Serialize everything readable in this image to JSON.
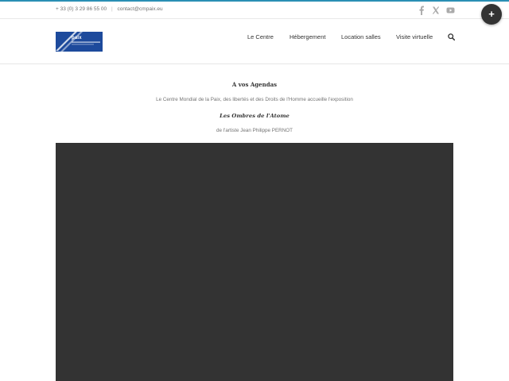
{
  "topbar": {
    "phone": "+ 33 (0) 3 29 86 55 00",
    "separator": "|",
    "email": "contact@cmpaix.eu",
    "social": [
      "facebook-icon",
      "x-icon",
      "youtube-icon"
    ]
  },
  "logo": {
    "text": "paix"
  },
  "nav": {
    "items": [
      {
        "label": "Le Centre"
      },
      {
        "label": "Hébergement"
      },
      {
        "label": "Location salles"
      },
      {
        "label": "Visite virtuelle"
      }
    ],
    "search_icon": "search-icon"
  },
  "floating_button": {
    "label": "+"
  },
  "content": {
    "heading": "A vos Agendas",
    "intro": "Le Centre Mondial de la Paix, des libertés et des Droits de l'Homme accueille l'exposition",
    "exhibition_title": "Les Ombres de l'Atome",
    "artist": "de l'artiste Jean Philippe PERNOT"
  },
  "colors": {
    "accent": "#2a8fb4",
    "logo_blue": "#1d4a9c",
    "media_bg": "#333333",
    "text": "#747474",
    "nav_text": "#333333"
  }
}
